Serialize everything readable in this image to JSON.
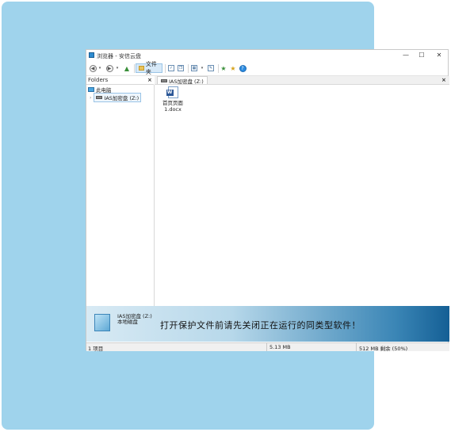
{
  "window": {
    "title": "浏览器 - 安信云盘"
  },
  "window_controls": {
    "minimize": "—",
    "maximize": "☐",
    "close": "✕"
  },
  "toolbar": {
    "back_glyph": "◀",
    "forward_glyph": "▶",
    "up_glyph": "▲",
    "folder_label": "文件夹",
    "dropdown_glyph": "▾",
    "star_glyph": "★",
    "help_glyph": "?"
  },
  "folders_pane": {
    "title": "Folders",
    "close": "×",
    "items": [
      {
        "label": "此电脑"
      },
      {
        "label": "IAS加密盘 (Z:)",
        "expander": "›"
      }
    ]
  },
  "tab": {
    "label": "IAS加密盘 (Z:)",
    "close": "×"
  },
  "files": [
    {
      "line1": "首页页面",
      "line2": "1.docx",
      "badge": "W"
    }
  ],
  "banner": {
    "drive_name": "IAS加密盘 (Z:)",
    "drive_type": "本地磁盘",
    "message": "打开保护文件前请先关闭正在运行的同类型软件！"
  },
  "status": {
    "items": "1 项目",
    "size": "5.13 MB",
    "free": "512 MB 剩余 (50%)"
  }
}
